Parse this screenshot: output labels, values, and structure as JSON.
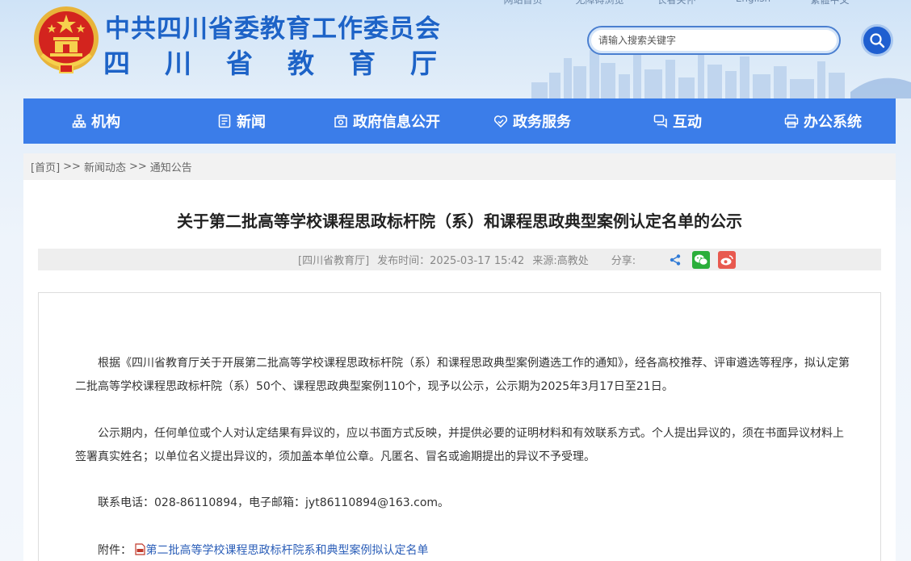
{
  "header": {
    "top_links": [
      "网站首页",
      "无障碍浏览",
      "长者关怀",
      "English",
      "繁體中文"
    ],
    "site_title": "中共四川省委教育工作委员会",
    "site_subtitle": "四川省教育厅",
    "search_placeholder": "请输入搜索关键字"
  },
  "nav": {
    "items": [
      {
        "label": "机构",
        "icon": "org-chart-icon"
      },
      {
        "label": "新闻",
        "icon": "news-icon"
      },
      {
        "label": "政府信息公开",
        "icon": "info-open-icon"
      },
      {
        "label": "政务服务",
        "icon": "service-heart-icon"
      },
      {
        "label": "互动",
        "icon": "interaction-icon"
      },
      {
        "label": "办公系统",
        "icon": "office-system-icon"
      }
    ]
  },
  "breadcrumb": {
    "home": "[首页]",
    "sep": ">>",
    "level1": "新闻动态",
    "level2": "通知公告"
  },
  "article": {
    "title": "关于第二批高等学校课程思政标杆院（系）和课程思政典型案例认定名单的公示",
    "meta": {
      "publisher": "[四川省教育厅]",
      "publish_time": "发布时间：2025-03-17 15:42",
      "source": "来源:高教处",
      "share_label": "分享:"
    },
    "paragraphs": [
      "根据《四川省教育厅关于开展第二批高等学校课程思政标杆院（系）和课程思政典型案例遴选工作的通知》，经各高校推荐、评审遴选等程序，拟认定第二批高等学校课程思政标杆院（系）50个、课程思政典型案例110个，现予以公示，公示期为2025年3月17日至21日。",
      "公示期内，任何单位或个人对认定结果有异议的，应以书面方式反映，并提供必要的证明材料和有效联系方式。个人提出异议的，须在书面异议材料上签署真实姓名；以单位名义提出异议的，须加盖本单位公章。凡匿名、冒名或逾期提出的异议不予受理。",
      "联系电话：028-86110894，电子邮箱：jyt86110894@163.com。"
    ],
    "attachment_label": "附件：",
    "attachment_name": "第二批高等学校课程思政标杆院系和典型案例拟认定名单"
  },
  "colors": {
    "brand_blue": "#1d63c7",
    "nav_blue": "#3b7de9",
    "wechat_green": "#2aae3a",
    "weibo_red": "#e8594f"
  }
}
